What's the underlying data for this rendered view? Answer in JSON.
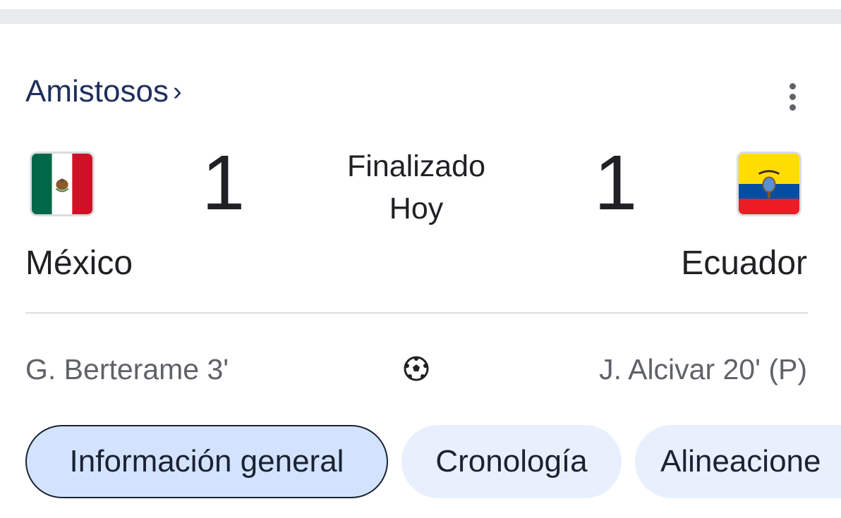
{
  "competition": {
    "label": "Amistosos",
    "chevron": "›"
  },
  "match": {
    "status": "Finalizado",
    "date": "Hoy",
    "home": {
      "name": "México",
      "score": "1",
      "flag_icon": "mexico-flag-icon",
      "scorer": "G. Berterame 3'"
    },
    "away": {
      "name": "Ecuador",
      "score": "1",
      "flag_icon": "ecuador-flag-icon",
      "scorer": "J. Alcivar 20' (P)"
    },
    "goal_icon": "soccer-ball-icon"
  },
  "tabs": [
    {
      "label": "Información general",
      "active": true
    },
    {
      "label": "Cronología",
      "active": false
    },
    {
      "label": "Alineacione",
      "active": false
    }
  ],
  "colors": {
    "tab_active_bg": "#d3e3fd",
    "tab_bg": "#e8f0fe",
    "competition_text": "#1f2f5c",
    "mexico_green": "#006847",
    "mexico_red": "#ce1126",
    "ecuador_yellow": "#ffdd00",
    "ecuador_blue": "#034ea2",
    "ecuador_red": "#ed1c24"
  }
}
